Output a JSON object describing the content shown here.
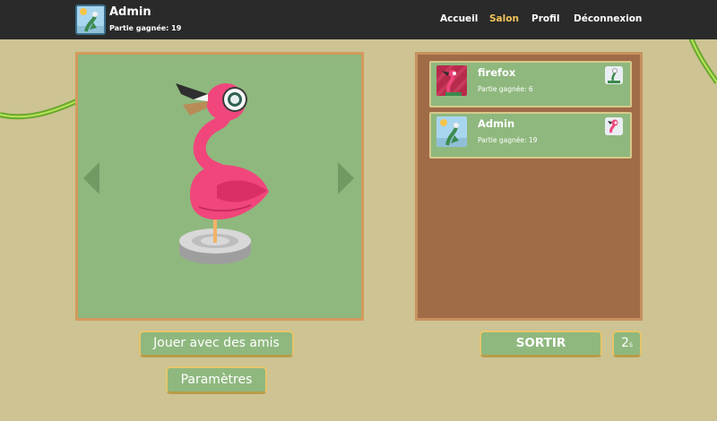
{
  "user": {
    "name": "Admin",
    "games_label": "Partie gagnée: 19"
  },
  "nav": {
    "home": "Accueil",
    "lobby": "Salon",
    "profile": "Profil",
    "logout": "Déconnexion",
    "active": "Salon"
  },
  "players": [
    {
      "name": "firefox",
      "games_label": "Partie gagnée: 6"
    },
    {
      "name": "Admin",
      "games_label": "Partie gagnée: 19"
    }
  ],
  "buttons": {
    "play_friends": "Jouer avec des amis",
    "settings": "Paramètres",
    "leave": "SORTIR",
    "timer_value": "2",
    "timer_unit": "s"
  },
  "colors": {
    "topbar": "#2a2a2a",
    "background": "#cdc393",
    "panel_green": "#8fb87e",
    "panel_brown": "#a06c47",
    "nav_active": "#f3c45a",
    "flamingo": "#f0467c"
  }
}
